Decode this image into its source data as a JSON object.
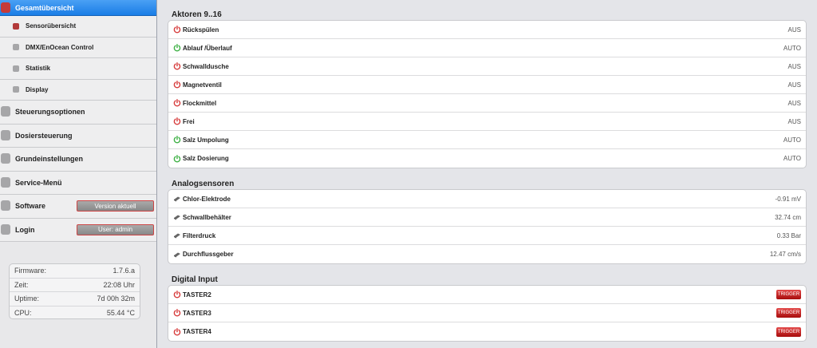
{
  "sidebar": {
    "active": "Gesamtübersicht",
    "subitems": [
      "Sensorübersicht",
      "DMX/EnOcean Control",
      "Statistik",
      "Display"
    ],
    "items": [
      "Steuerungsoptionen",
      "Dosiersteuerung",
      "Grundeinstellungen",
      "Service-Menü"
    ],
    "software": {
      "label": "Software",
      "button": "Version aktuell"
    },
    "login": {
      "label": "Login",
      "button": "User: admin"
    },
    "info": [
      {
        "label": "Firmware:",
        "value": "1.7.6.a"
      },
      {
        "label": "Zeit:",
        "value": "22:08 Uhr"
      },
      {
        "label": "Uptime:",
        "value": "7d 00h 32m"
      },
      {
        "label": "CPU:",
        "value": "55.44 °C"
      }
    ]
  },
  "aktoren": {
    "title": "Aktoren 9..16",
    "rows": [
      {
        "name": "Rückspülen",
        "value": "AUS",
        "state": "red"
      },
      {
        "name": "Ablauf /Überlauf",
        "value": "AUTO",
        "state": "green"
      },
      {
        "name": "Schwalldusche",
        "value": "AUS",
        "state": "red"
      },
      {
        "name": "Magnetventil",
        "value": "AUS",
        "state": "red"
      },
      {
        "name": "Flockmittel",
        "value": "AUS",
        "state": "red"
      },
      {
        "name": "Frei",
        "value": "AUS",
        "state": "red"
      },
      {
        "name": "Salz Umpolung",
        "value": "AUTO",
        "state": "green"
      },
      {
        "name": "Salz Dosierung",
        "value": "AUTO",
        "state": "green"
      }
    ]
  },
  "analog": {
    "title": "Analogsensoren",
    "rows": [
      {
        "name": "Chlor-Elektrode",
        "value": "-0.91 mV"
      },
      {
        "name": "Schwallbehälter",
        "value": "32.74 cm"
      },
      {
        "name": "Filterdruck",
        "value": "0.33 Bar"
      },
      {
        "name": "Durchflussgeber",
        "value": "12.47 cm/s"
      }
    ]
  },
  "digital": {
    "title": "Digital Input",
    "trigger_label": "TRIGGER",
    "rows": [
      {
        "name": "TASTER2"
      },
      {
        "name": "TASTER3"
      },
      {
        "name": "TASTER4"
      }
    ]
  },
  "colors": {
    "red_icon": "#d63a3a",
    "green_icon": "#3cb043",
    "active_blue": "#1a7de6"
  }
}
